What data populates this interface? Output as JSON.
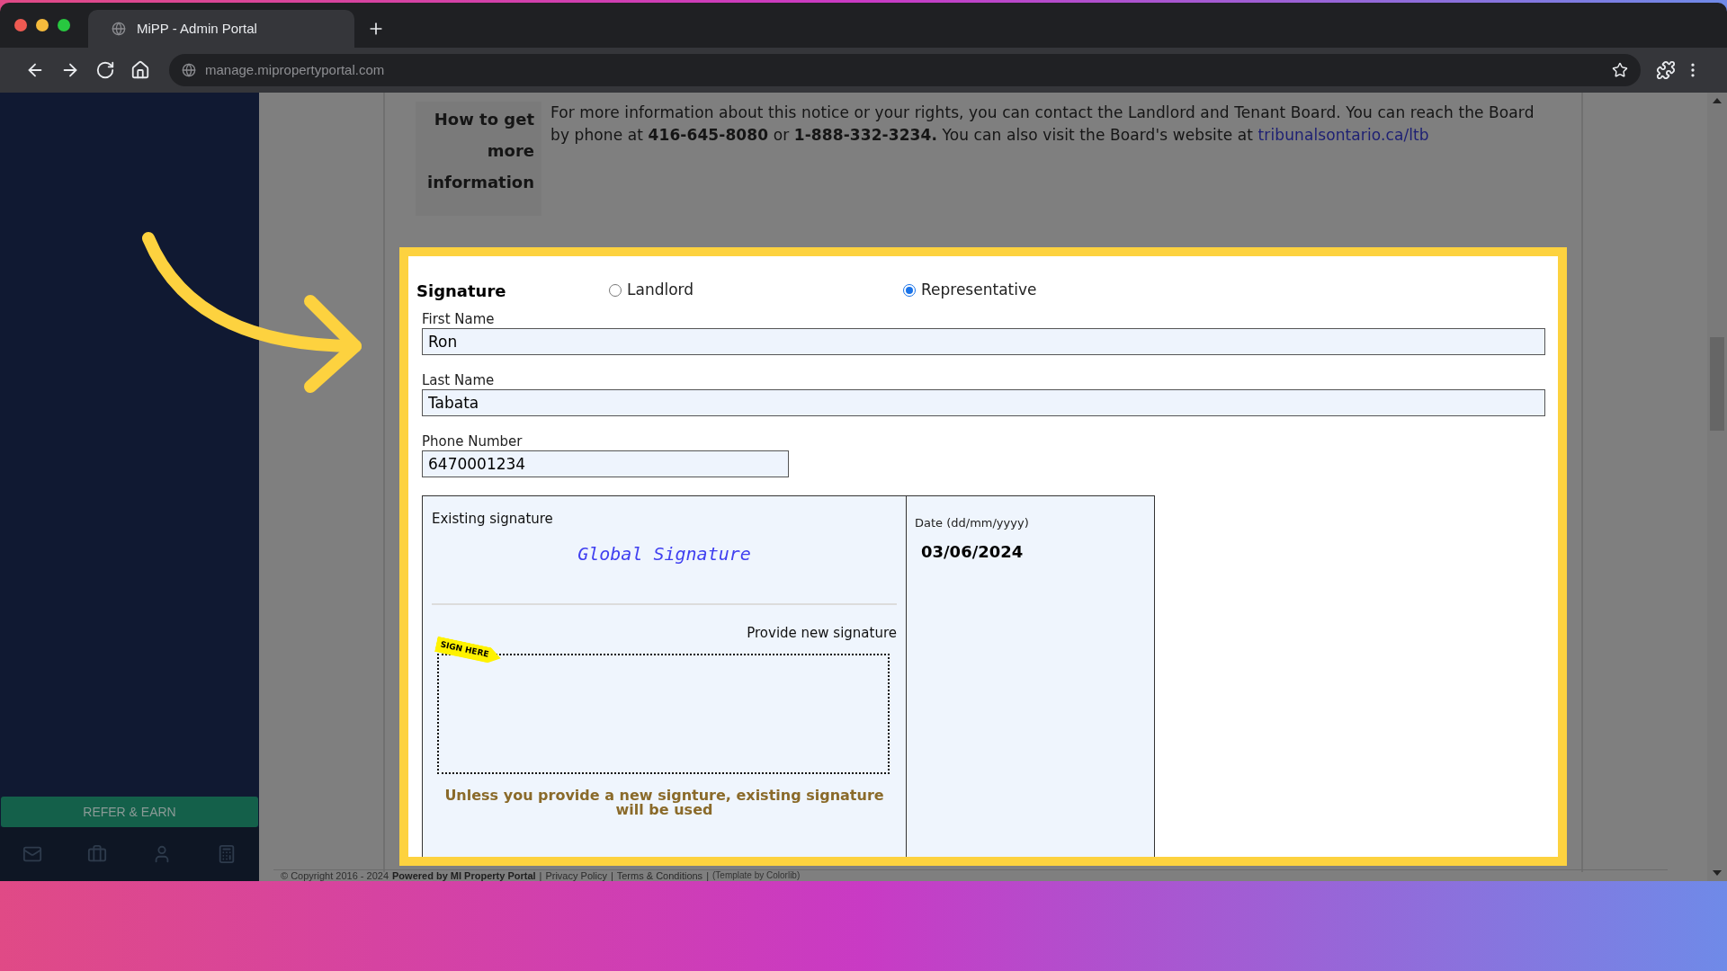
{
  "browser": {
    "tab_title": "MiPP - Admin Portal",
    "url": "manage.mipropertyportal.com"
  },
  "sidebar": {
    "refer_button": "REFER & EARN"
  },
  "info": {
    "heading": "How to get more information",
    "text": "For more information about this notice or your rights, you can contact the Landlord and Tenant Board. You can reach the Board by phone at **416-645-8080** or **1-888-332-3234.** You can also visit the Board's website at",
    "link": "tribunalsontario.ca/ltb"
  },
  "signature": {
    "title": "Signature",
    "roles": [
      {
        "label": "Landlord",
        "selected": false
      },
      {
        "label": "Representative",
        "selected": true
      }
    ],
    "fields": [
      {
        "label": "First Name",
        "value": "Ron",
        "kind": "wide"
      },
      {
        "label": "Last Name",
        "value": "Tabata",
        "kind": "wide"
      },
      {
        "label": "Phone Number",
        "value": "6470001234",
        "kind": "short"
      }
    ],
    "existing_label": "Existing signature",
    "existing_value": "Global Signature",
    "new_label": "Provide new signature",
    "sign_here": "SIGN HERE",
    "note": "Unless you provide a new signture, existing signature will be used",
    "date_label": "Date (dd/mm/yyyy)",
    "date_value": "03/06/2024"
  },
  "footer": [
    {
      "text": "© Copyright 2016 - 2024",
      "kind": "plain"
    },
    {
      "text": "Powered by MI Property Portal",
      "kind": "bold"
    },
    {
      "text": "|",
      "kind": "sep"
    },
    {
      "text": "Privacy Policy",
      "kind": "link"
    },
    {
      "text": "|",
      "kind": "sep"
    },
    {
      "text": "Terms & Conditions",
      "kind": "link"
    },
    {
      "text": "|",
      "kind": "sep"
    },
    {
      "text": "(Template by Colorlib)",
      "kind": "small"
    }
  ]
}
